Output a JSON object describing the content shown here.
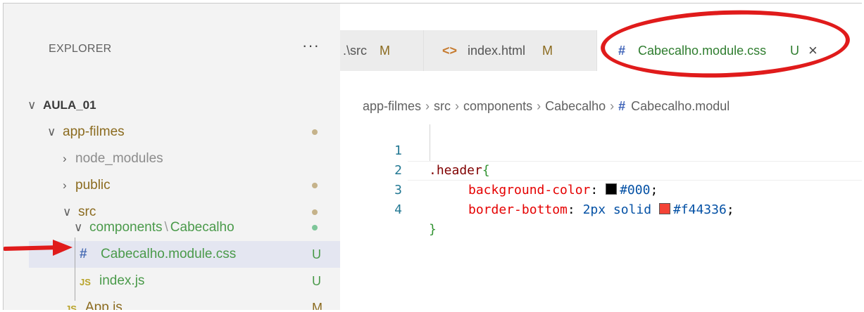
{
  "explorer": {
    "title": "EXPLORER",
    "more": "···",
    "workspace": "AULA_01",
    "tree": [
      {
        "chevron": "∨",
        "label": "app-filmes",
        "status_dot": "#c5b28a"
      },
      {
        "chevron": "›",
        "label": "node_modules"
      },
      {
        "chevron": "›",
        "label": "public",
        "status_dot": "#c5b28a"
      },
      {
        "chevron": "∨",
        "label": "src",
        "status_dot": "#c5b28a"
      },
      {
        "chevron": "∨",
        "label_a": "components",
        "label_sep": "\\",
        "label_b": "Cabecalho",
        "status_dot": "#7ec699"
      },
      {
        "icon": "#",
        "label": "Cabecalho.module.css",
        "status": "U",
        "selected": true
      },
      {
        "icon": "JS",
        "label": "index.js",
        "status": "U"
      },
      {
        "icon": "JS",
        "label": "App.js",
        "status": "M"
      }
    ]
  },
  "tabs": [
    {
      "label": ".\\src",
      "status": "M"
    },
    {
      "icon": "<>",
      "label": "index.html",
      "status": "M"
    },
    {
      "icon": "#",
      "label": "Cabecalho.module.css",
      "status": "U",
      "close": "×",
      "active": true
    }
  ],
  "breadcrumb": {
    "parts": [
      "app-filmes",
      "src",
      "components",
      "Cabecalho"
    ],
    "file_icon": "#",
    "file": "Cabecalho.modul",
    "separator": "›"
  },
  "code": {
    "line_numbers": [
      "1",
      "2",
      "3",
      "4"
    ],
    "line1_selector": ".header",
    "line1_brace": "{",
    "line2_prop": "background-color",
    "line2_colon": ": ",
    "line2_value": "#000",
    "line2_semi": ";",
    "line3_prop": "border-bottom",
    "line3_colon": ": ",
    "line3_value_a": "2px solid ",
    "line3_value_b": "#f44336",
    "line3_semi": ";",
    "line4_brace": "}"
  },
  "colors": {
    "swatch_black": "#000000",
    "swatch_red": "#f44336",
    "status_untracked": "#4a9a4a",
    "status_modified": "#8b6b1f",
    "annotation": "#e01b1b"
  }
}
